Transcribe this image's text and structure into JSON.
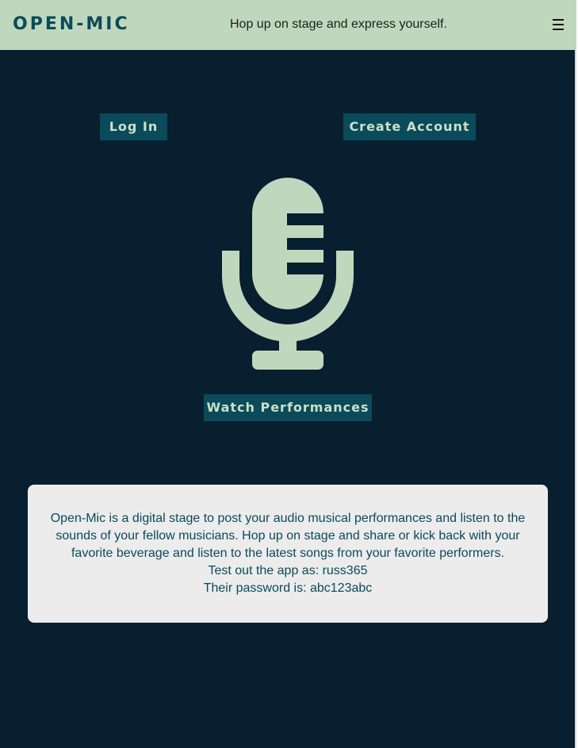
{
  "header": {
    "brand": "OPEN-MIC",
    "tagline": "Hop up on stage and express yourself.",
    "menu_icon": "hamburger-menu-icon"
  },
  "auth": {
    "login_label": "Log In",
    "create_account_label": "Create Account"
  },
  "hero": {
    "icon": "microphone-icon",
    "watch_label": "Watch Performances"
  },
  "info": {
    "description": "Open-Mic is a digital stage to post your audio musical performances and listen to the sounds of your fellow musicians. Hop up on stage and share or kick back with your favorite beverage and listen to the latest songs from your favorite performers.",
    "test_user": "Test out the app as: russ365",
    "test_password": "Their password is: abc123abc"
  },
  "colors": {
    "background": "#071f2e",
    "header": "#bfd8bd",
    "accent": "#0b4a5a",
    "button_text": "#c9e0c7",
    "card": "#ececec"
  }
}
